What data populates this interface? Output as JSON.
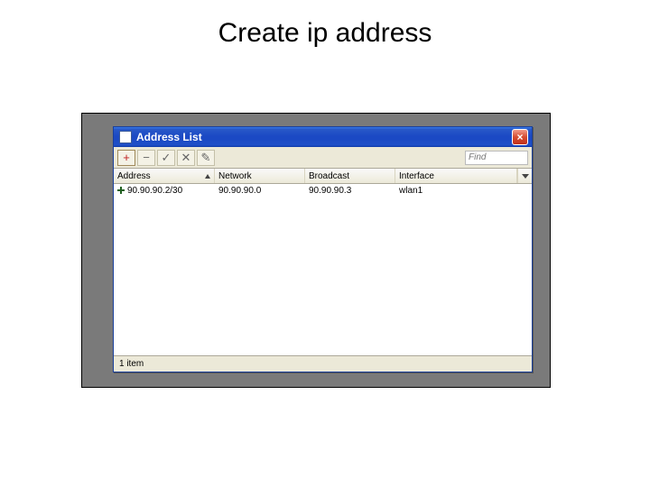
{
  "page": {
    "title": "Create ip address"
  },
  "window": {
    "title": "Address List",
    "close_label": "×"
  },
  "toolbar": {
    "add": "+",
    "remove": "−",
    "enable": "✓",
    "disable": "✕",
    "comment": "✎",
    "find_placeholder": "Find"
  },
  "columns": {
    "address": "Address",
    "network": "Network",
    "broadcast": "Broadcast",
    "interface": "Interface"
  },
  "rows": [
    {
      "address": "90.90.90.2/30",
      "network": "90.90.90.0",
      "broadcast": "90.90.90.3",
      "interface": "wlan1"
    }
  ],
  "status": {
    "items": "1 item"
  }
}
